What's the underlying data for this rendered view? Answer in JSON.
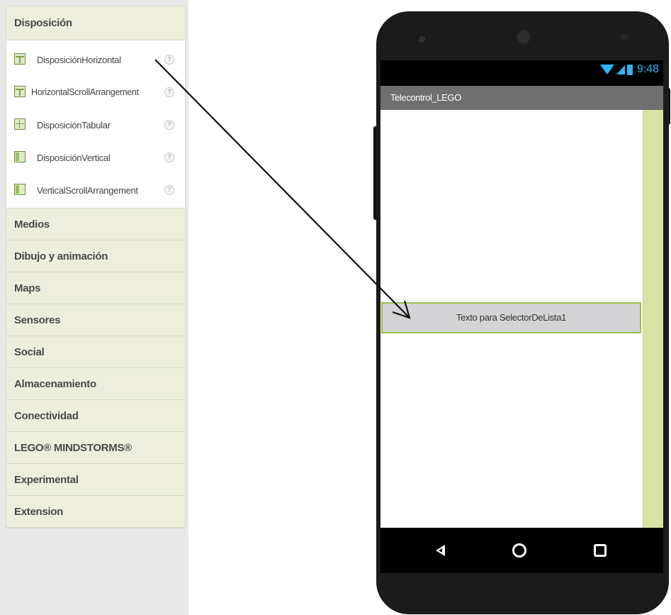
{
  "palette": {
    "active_category": "Disposición",
    "components": [
      {
        "label": "DisposiciónHorizontal",
        "icon": "horizontal-arrangement-icon",
        "help": "?"
      },
      {
        "label": "HorizontalScrollArrangement",
        "icon": "horizontal-scroll-arrangement-icon",
        "help": "?"
      },
      {
        "label": "DisposiciónTabular",
        "icon": "table-arrangement-icon",
        "help": "?"
      },
      {
        "label": "DisposiciónVertical",
        "icon": "vertical-arrangement-icon",
        "help": "?"
      },
      {
        "label": "VerticalScrollArrangement",
        "icon": "vertical-scroll-arrangement-icon",
        "help": "?"
      }
    ],
    "categories": [
      "Medios",
      "Dibujo y animación",
      "Maps",
      "Sensores",
      "Social",
      "Almacenamiento",
      "Conectividad",
      "LEGO® MINDSTORMS®",
      "Experimental",
      "Extension"
    ]
  },
  "phone": {
    "status_time": "9:48",
    "app_title": "Telecontrol_LEGO",
    "list_picker_text": "Texto para SelectorDeLista1"
  },
  "colors": {
    "status_icons": "#29b6f6",
    "palette_header": "#edefdc",
    "picker_border": "#9cbf45",
    "screen_side": "#d9e4a3"
  }
}
